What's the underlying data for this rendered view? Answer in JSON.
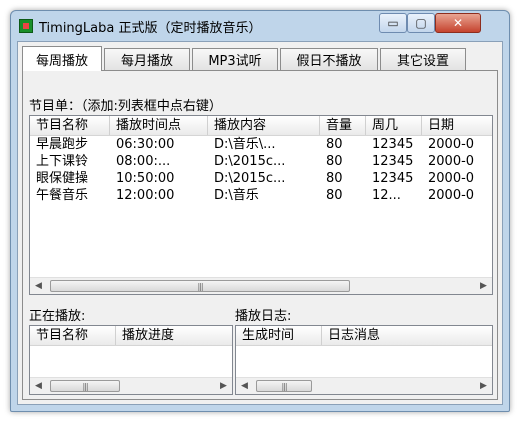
{
  "window": {
    "title": "TimingLaba   正式版（定时播放音乐）",
    "minimize_glyph": "▭",
    "maximize_glyph": "▢",
    "close_glyph": "✕"
  },
  "tabs": [
    {
      "label": "每周播放",
      "active": true
    },
    {
      "label": "每月播放",
      "active": false
    },
    {
      "label": "MP3试听",
      "active": false
    },
    {
      "label": "假日不播放",
      "active": false
    },
    {
      "label": "其它设置",
      "active": false
    }
  ],
  "program_list": {
    "label": "节目单：（添加:列表框中点右键）",
    "columns": [
      "节目名称",
      "播放时间点",
      "播放内容",
      "音量",
      "周几",
      "日期"
    ],
    "rows": [
      [
        "早晨跑步",
        "06:30:00",
        "D:\\音乐\\...",
        "80",
        "12345",
        "2000-0"
      ],
      [
        "上下课铃",
        "08:00:...",
        "D:\\2015c...",
        "80",
        "12345",
        "2000-0"
      ],
      [
        "眼保健操",
        "10:50:00",
        "D:\\2015c...",
        "80",
        "12345",
        "2000-0"
      ],
      [
        "午餐音乐",
        "12:00:00",
        "D:\\音乐",
        "80",
        "12...",
        "2000-0"
      ]
    ]
  },
  "now_playing": {
    "label": "正在播放:",
    "columns": [
      "节目名称",
      "播放进度"
    ]
  },
  "play_log": {
    "label": "播放日志:",
    "columns": [
      "生成时间",
      "日志消息"
    ]
  },
  "scrollbar": {
    "left_glyph": "◀",
    "right_glyph": "▶",
    "grip_glyph": "|||"
  }
}
